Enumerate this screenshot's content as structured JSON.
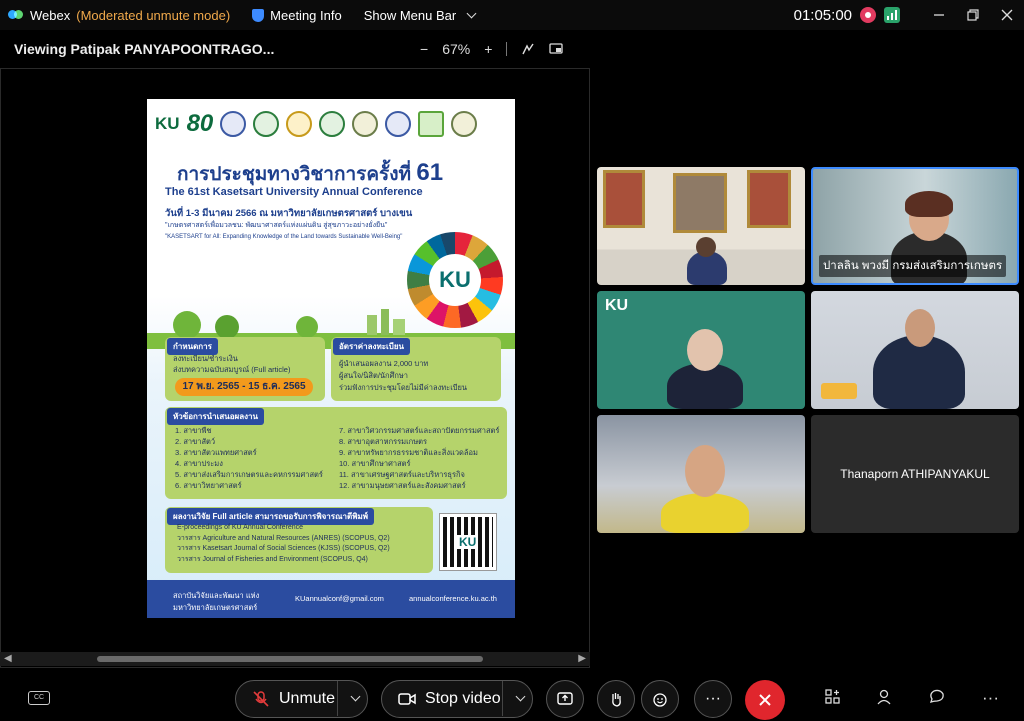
{
  "titlebar": {
    "app_name": "Webex",
    "mode": "(Moderated unmute mode)",
    "meeting_info": "Meeting Info",
    "show_menu_bar": "Show Menu Bar",
    "timer": "01:05:00"
  },
  "viewer": {
    "title": "Viewing Patipak PANYAPOONTRAGO...",
    "zoom_out": "−",
    "zoom": "67%",
    "zoom_in": "+"
  },
  "poster": {
    "title_th": "การประชุมทางวิชาการครั้งที่",
    "title_num": "61",
    "title_en": "The 61st Kasetsart University Annual Conference",
    "date_line": "วันที่ 1-3 มีนาคม 2566 ณ มหาวิทยาลัยเกษตรศาสตร์ บางเขน",
    "theme_th": "\"เกษตรศาสตร์เพื่อมวลชน: พัฒนาศาสตร์แห่งแผ่นดิน สู่สุขภาวะอย่างยั่งยืน\"",
    "theme_en": "\"KASETSART for All: Expanding Knowledge of the Land towards Sustainable Well-Being\"",
    "schedule_header": "กำหนดการ",
    "schedule_line1": "ลงทะเบียน/ชำระเงิน",
    "schedule_line2": "ส่งบทความฉบับสมบูรณ์ (Full article)",
    "schedule_dates": "17 พ.ย. 2565 - 15 ธ.ค. 2565",
    "fee_header": "อัตราค่าลงทะเบียน",
    "fee_line1": "ผู้นำเสนอผลงาน 2,000 บาท",
    "fee_line2": "ผู้สนใจ/นิสิต/นักศึกษา",
    "fee_line3": "ร่วมฟังการประชุมโดยไม่มีค่าลงทะเบียน",
    "topics_header": "หัวข้อการนำเสนอผลงาน",
    "topics_left": [
      "1. สาขาพืช",
      "2. สาขาสัตว์",
      "3. สาขาสัตวแพทยศาสตร์",
      "4. สาขาประมง",
      "5. สาขาส่งเสริมการเกษตรและคหกรรมศาสตร์",
      "6. สาขาวิทยาศาสตร์"
    ],
    "topics_right": [
      "7. สาขาวิศวกรรมศาสตร์และสถาปัตยกรรมศาสตร์",
      "8. สาขาอุตสาหกรรมเกษตร",
      "9. สาขาทรัพยากรธรรมชาติและสิ่งแวดล้อม",
      "10. สาขาศึกษาศาสตร์",
      "11. สาขาเศรษฐศาสตร์และบริหารธุรกิจ",
      "12. สาขามนุษยศาสตร์และสังคมศาสตร์"
    ],
    "publish_header": "ผลงานวิจัย Full article สามารถขอรับการพิจารณาตีพิมพ์",
    "publish_items": [
      "E-proceedings of KU Annual Conference",
      "วารสาร Agriculture and Natural Resources (ANRES) (SCOPUS, Q2)",
      "วารสาร Kasetsart Journal of Social Sciences (KJSS) (SCOPUS, Q2)",
      "วารสาร Journal of Fisheries and Environment (SCOPUS, Q4)"
    ],
    "footer_org": "สถาบันวิจัยและพัฒนา แห่งมหาวิทยาลัยเกษตรศาสตร์",
    "footer_email": "KUannualconf@gmail.com",
    "footer_web": "annualconference.ku.ac.th",
    "logo_ku": "KU",
    "logo_80": "80"
  },
  "participants": [
    {
      "name": ""
    },
    {
      "name": "ปาลลิน พวงมี กรมส่งเสริมการเกษตร"
    },
    {
      "name": ""
    },
    {
      "name": ""
    },
    {
      "name": ""
    },
    {
      "name": "Thanaporn ATHIPANYAKUL"
    }
  ],
  "controls": {
    "cc": "CC",
    "unmute": "Unmute",
    "stop_video": "Stop video",
    "more": "···"
  },
  "colors": {
    "moderated": "#f0a94b",
    "end_button": "#e0262d",
    "active_speaker_border": "#3d8bff"
  }
}
